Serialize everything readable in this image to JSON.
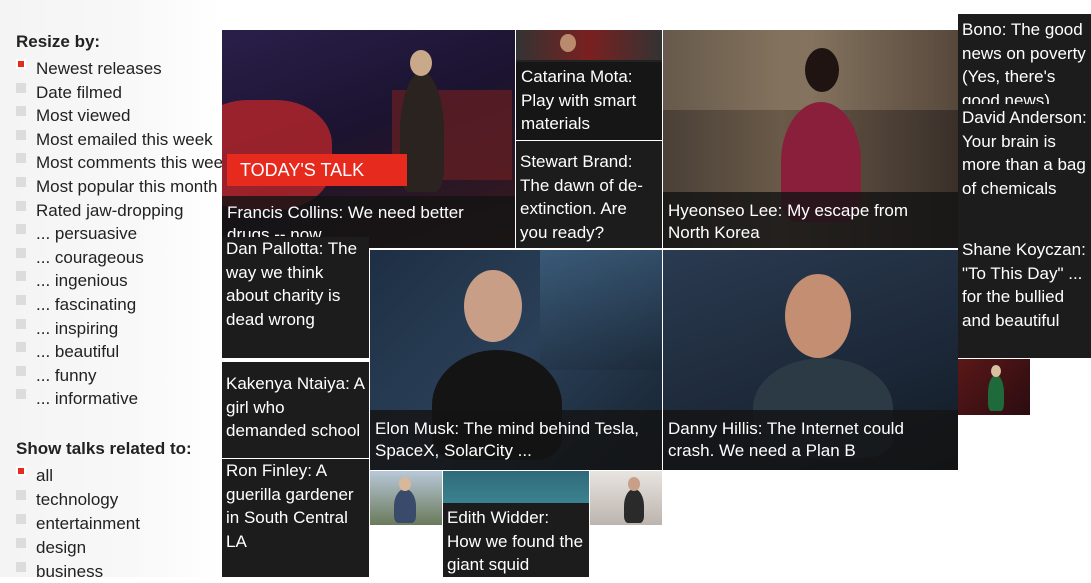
{
  "resize": {
    "heading": "Resize by:",
    "options": [
      {
        "label": "Newest releases",
        "selected": true
      },
      {
        "label": "Date filmed",
        "selected": false
      },
      {
        "label": "Most viewed",
        "selected": false
      },
      {
        "label": "Most emailed this week",
        "selected": false
      },
      {
        "label": "Most comments this week",
        "selected": false
      },
      {
        "label": "Most popular this month",
        "selected": false
      },
      {
        "label": "Rated jaw-dropping",
        "selected": false
      },
      {
        "label": "... persuasive",
        "selected": false
      },
      {
        "label": "... courageous",
        "selected": false
      },
      {
        "label": "... ingenious",
        "selected": false
      },
      {
        "label": "... fascinating",
        "selected": false
      },
      {
        "label": "... inspiring",
        "selected": false
      },
      {
        "label": "... beautiful",
        "selected": false
      },
      {
        "label": "... funny",
        "selected": false
      },
      {
        "label": "... informative",
        "selected": false
      }
    ]
  },
  "topics": {
    "heading": "Show talks related to:",
    "options": [
      {
        "label": "all",
        "selected": true
      },
      {
        "label": "technology",
        "selected": false
      },
      {
        "label": "entertainment",
        "selected": false
      },
      {
        "label": "design",
        "selected": false
      },
      {
        "label": "business",
        "selected": false
      }
    ]
  },
  "badge": "TODAY'S TALK",
  "talks": {
    "collins": "Francis Collins: We need better drugs -- now",
    "mota": "Catarina Mota: Play with smart materials",
    "brand": "Stewart Brand: The dawn of de-extinction. Are you ready?",
    "lee": "Hyeonseo Lee: My escape from North Korea",
    "bono": "Bono: The good news on poverty (Yes, there's good news)",
    "anderson": "David Anderson: Your brain is more than a bag of chemicals",
    "koyczan": "Shane Koyczan: \"To This Day\" ... for the bullied and beautiful",
    "pallotta": "Dan Pallotta: The way we think about charity is dead wrong",
    "musk": "Elon Musk: The mind behind Tesla, SpaceX, SolarCity ...",
    "hillis": "Danny Hillis: The Internet could crash. We need a Plan B",
    "ntaiya": "Kakenya Ntaiya: A girl who demanded school",
    "finley": "Ron Finley: A guerilla gardener in South Central LA",
    "widder": "Edith Widder: How we found the giant squid"
  },
  "colors": {
    "accent": "#e62b1e",
    "caption_bg": "#141414"
  }
}
